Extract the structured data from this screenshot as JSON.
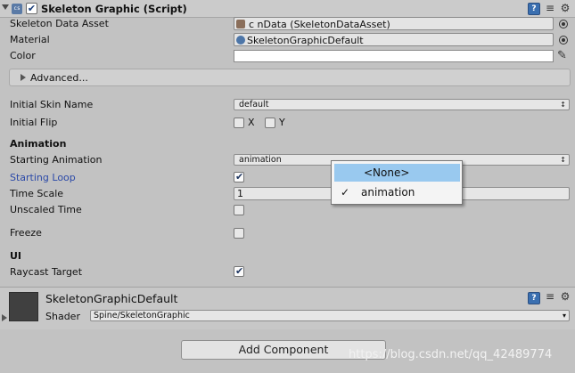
{
  "component": {
    "title": "Skeleton Graphic (Script)",
    "enabled": true,
    "script_icon": "cs"
  },
  "fields": {
    "skeleton_data_asset": {
      "label": "Skeleton Data Asset",
      "value": "c                            nData (SkeletonDataAsset)"
    },
    "material": {
      "label": "Material",
      "value": "SkeletonGraphicDefault"
    },
    "color": {
      "label": "Color",
      "value": "#ffffff"
    },
    "advanced": {
      "label": "Advanced..."
    },
    "initial_skin": {
      "label": "Initial Skin Name",
      "value": "default"
    },
    "initial_flip": {
      "label": "Initial Flip",
      "x_label": "X",
      "y_label": "Y",
      "x": false,
      "y": false
    },
    "animation_header": "Animation",
    "starting_animation": {
      "label": "Starting Animation",
      "value": "animation"
    },
    "starting_loop": {
      "label": "Starting Loop",
      "value": true
    },
    "time_scale": {
      "label": "Time Scale",
      "value": "1"
    },
    "unscaled_time": {
      "label": "Unscaled Time",
      "value": false
    },
    "freeze": {
      "label": "Freeze",
      "value": false
    },
    "ui_header": "UI",
    "raycast_target": {
      "label": "Raycast Target",
      "value": true
    }
  },
  "material_section": {
    "title": "SkeletonGraphicDefault",
    "shader_label": "Shader",
    "shader_value": "Spine/SkeletonGraphic"
  },
  "add_component_label": "Add Component",
  "watermark": "https://blog.csdn.net/qq_42489774",
  "dropdown": {
    "items": [
      {
        "label": "<None>",
        "highlighted": true,
        "checked": false
      },
      {
        "label": "animation",
        "highlighted": false,
        "checked": true
      }
    ]
  },
  "colors": {
    "background": "#c2c2c2",
    "highlight": "#99c9ef",
    "label_blue": "#2b49a8",
    "help_icon": "#3a6fb0"
  },
  "icons": {
    "check": "✔",
    "dropdown_arrow": "↕",
    "eyedropper": "✎"
  }
}
